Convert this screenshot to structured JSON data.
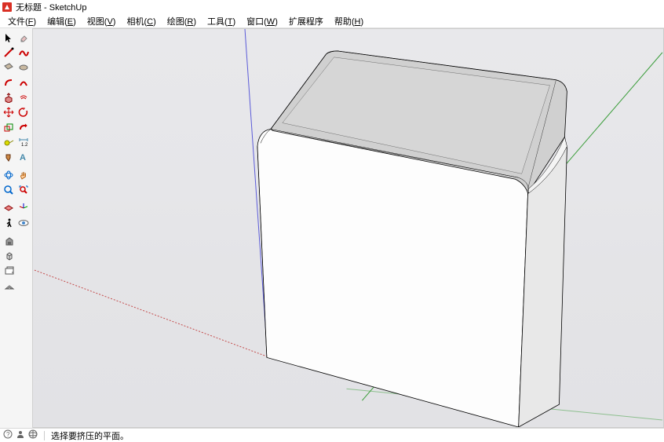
{
  "title": "无标题 - SketchUp",
  "menu": {
    "file": {
      "label": "文件",
      "key": "F"
    },
    "edit": {
      "label": "编辑",
      "key": "E"
    },
    "view": {
      "label": "视图",
      "key": "V"
    },
    "camera": {
      "label": "相机",
      "key": "C"
    },
    "draw": {
      "label": "绘图",
      "key": "R"
    },
    "tools": {
      "label": "工具",
      "key": "T"
    },
    "window": {
      "label": "窗口",
      "key": "W"
    },
    "extensions": {
      "label": "扩展程序"
    },
    "help": {
      "label": "帮助",
      "key": "H"
    }
  },
  "status": {
    "hint": "选择要挤压的平面。"
  }
}
